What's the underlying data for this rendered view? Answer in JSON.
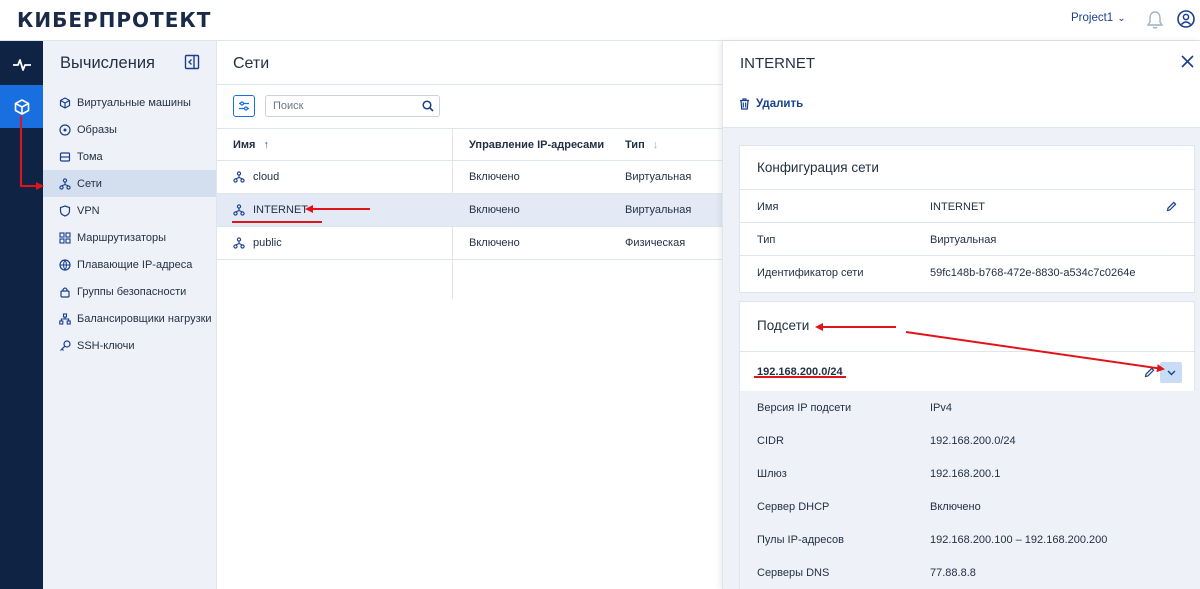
{
  "header": {
    "logo": "КИБЕРПРОТЕКТ",
    "project": "Project1"
  },
  "sidebar": {
    "title": "Вычисления",
    "items": [
      {
        "label": "Виртуальные машины",
        "icon": "cube-icon"
      },
      {
        "label": "Образы",
        "icon": "disc-icon"
      },
      {
        "label": "Тома",
        "icon": "volume-icon"
      },
      {
        "label": "Сети",
        "icon": "network-icon",
        "active": true
      },
      {
        "label": "VPN",
        "icon": "shield-icon"
      },
      {
        "label": "Маршрутизаторы",
        "icon": "router-icon"
      },
      {
        "label": "Плавающие IP-адреса",
        "icon": "globe-icon"
      },
      {
        "label": "Группы безопасности",
        "icon": "lock-icon"
      },
      {
        "label": "Балансировщики нагрузки",
        "icon": "balancer-icon"
      },
      {
        "label": "SSH-ключи",
        "icon": "key-icon"
      }
    ]
  },
  "networks": {
    "title": "Сети",
    "search_placeholder": "Поиск",
    "columns": [
      "Имя",
      "Управление IP-адресами",
      "Тип"
    ],
    "rows": [
      {
        "name": "cloud",
        "ip_management": "Включено",
        "type": "Виртуальная"
      },
      {
        "name": "INTERNET",
        "ip_management": "Включено",
        "type": "Виртуальная",
        "selected": true
      },
      {
        "name": "public",
        "ip_management": "Включено",
        "type": "Физическая"
      }
    ]
  },
  "detail": {
    "title": "INTERNET",
    "delete_label": "Удалить",
    "config": {
      "title": "Конфигурация сети",
      "fields": [
        {
          "label": "Имя",
          "value": "INTERNET"
        },
        {
          "label": "Тип",
          "value": "Виртуальная"
        },
        {
          "label": "Идентификатор сети",
          "value": "59fc148b-b768-472e-8830-a534c7c0264e"
        }
      ]
    },
    "subnets": {
      "title": "Подсети",
      "subnet_name": "192.168.200.0/24",
      "fields": [
        {
          "label": "Версия IP подсети",
          "value": "IPv4"
        },
        {
          "label": "CIDR",
          "value": "192.168.200.0/24"
        },
        {
          "label": "Шлюз",
          "value": "192.168.200.1"
        },
        {
          "label": "Сервер DHCP",
          "value": "Включено"
        },
        {
          "label": "Пулы IP-адресов",
          "value": "192.168.200.100 – 192.168.200.200"
        },
        {
          "label": "Серверы DNS",
          "value": "77.88.8.8"
        }
      ]
    }
  },
  "colors": {
    "accent": "#1a6fe0",
    "rail": "#0f2344",
    "annotation": "#e0151b"
  }
}
